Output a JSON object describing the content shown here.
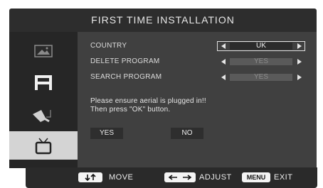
{
  "title": "FIRST TIME INSTALLATION",
  "sidebar": {
    "items": [
      {
        "icon": "picture-icon"
      },
      {
        "icon": "sound-icon"
      },
      {
        "icon": "setup-icon"
      },
      {
        "icon": "tv-icon",
        "active": true
      }
    ]
  },
  "settings": [
    {
      "label": "COUNTRY",
      "value": "UK",
      "active": true
    },
    {
      "label": "DELETE PROGRAM",
      "value": "YES",
      "active": false
    },
    {
      "label": "SEARCH PROGRAM",
      "value": "YES",
      "active": false
    }
  ],
  "message": {
    "line1": "Please ensure aerial is plugged in!!",
    "line2": "Then press \"OK\" button."
  },
  "buttons": {
    "yes": "YES",
    "no": "NO"
  },
  "footer": {
    "move": "MOVE",
    "adjust": "ADJUST",
    "menu_key": "MENU",
    "exit": "EXIT"
  },
  "colors": {
    "panel": "#404040",
    "sidebar": "#262626",
    "highlight": "#d4d4d4"
  }
}
